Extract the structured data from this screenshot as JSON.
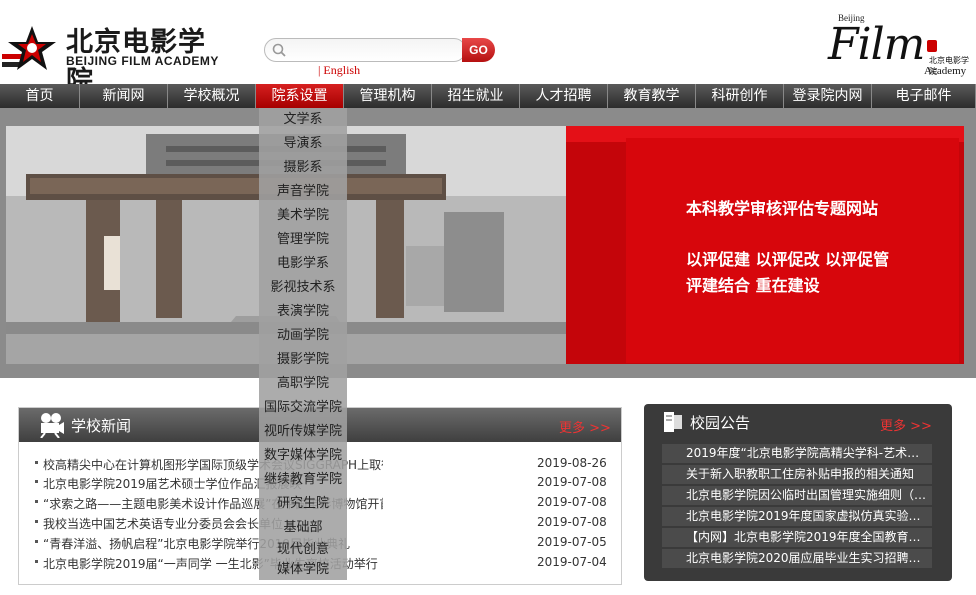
{
  "header": {
    "logo_cn": "北京电影学院",
    "logo_en": "BEIJING FILM ACADEMY",
    "search_placeholder": "",
    "go_label": "GO",
    "lang_label": "| English",
    "film_beijing": "Beijing",
    "film_word": "Film",
    "film_cn": "北京电影学院",
    "film_academy": "Academy"
  },
  "nav": {
    "items": [
      {
        "label": "首页"
      },
      {
        "label": "新闻网"
      },
      {
        "label": "学校概况"
      },
      {
        "label": "院系设置"
      },
      {
        "label": "管理机构"
      },
      {
        "label": "招生就业"
      },
      {
        "label": "人才招聘"
      },
      {
        "label": "教育教学"
      },
      {
        "label": "科研创作"
      },
      {
        "label": "登录院内网"
      },
      {
        "label": "电子邮件"
      }
    ],
    "active_index": 3,
    "accent_color": "#c00000"
  },
  "dropdown": {
    "items": [
      {
        "label": "文学系"
      },
      {
        "label": "导演系"
      },
      {
        "label": "摄影系"
      },
      {
        "label": "声音学院"
      },
      {
        "label": "美术学院"
      },
      {
        "label": "管理学院"
      },
      {
        "label": "电影学系"
      },
      {
        "label": "影视技术系"
      },
      {
        "label": "表演学院"
      },
      {
        "label": "动画学院"
      },
      {
        "label": "摄影学院"
      },
      {
        "label": "高职学院"
      },
      {
        "label": "国际交流学院"
      },
      {
        "label": "视听传媒学院"
      },
      {
        "label": "数字媒体学院"
      },
      {
        "label": "继续教育学院"
      },
      {
        "label": "研究生院"
      },
      {
        "label": "基础部"
      },
      {
        "label": "现代创意"
      },
      {
        "label": "媒体学院"
      }
    ]
  },
  "banner": {
    "title": "本科教学审核评估专题网站",
    "line1": "以评促建  以评促改  以评促管",
    "line2": "评建结合  重在建设"
  },
  "news": {
    "title": "学校新闻",
    "more": "更多 >>",
    "rows": [
      {
        "text": "校高精尖中心在计算机图形学国际顶级学术会议SIGGRAPH上取得亮眼成绩",
        "date": "2019-08-26"
      },
      {
        "text": "北京电影学院2019届艺术硕士学位作品汇报展映",
        "date": "2019-07-08"
      },
      {
        "text": "“求索之路——主题电影美术设计作品巡展”在中国电影博物馆开首展帷幕",
        "date": "2019-07-08"
      },
      {
        "text": "我校当选中国艺术英语专业分委员会会长单位",
        "date": "2019-07-08"
      },
      {
        "text": "“青春洋溢、扬帆启程”北京电影学院举行2019届毕业典礼",
        "date": "2019-07-05"
      },
      {
        "text": "北京电影学院2019届“一声同学 一生北影”毕业生离校活动举行",
        "date": "2019-07-04"
      }
    ]
  },
  "notice": {
    "title": "校园公告",
    "more": "更多 >>",
    "rows": [
      {
        "text": "2019年度“北京电影学院高精尖学科-艺术…"
      },
      {
        "text": "关于新入职教职工住房补贴申报的相关通知"
      },
      {
        "text": "北京电影学院因公临时出国管理实施细则（…"
      },
      {
        "text": "北京电影学院2019年度国家虚拟仿真实验教…"
      },
      {
        "text": "【内网】北京电影学院2019年度全国教育系…"
      },
      {
        "text": "北京电影学院2020届应届毕业生实习招聘公告"
      }
    ]
  }
}
